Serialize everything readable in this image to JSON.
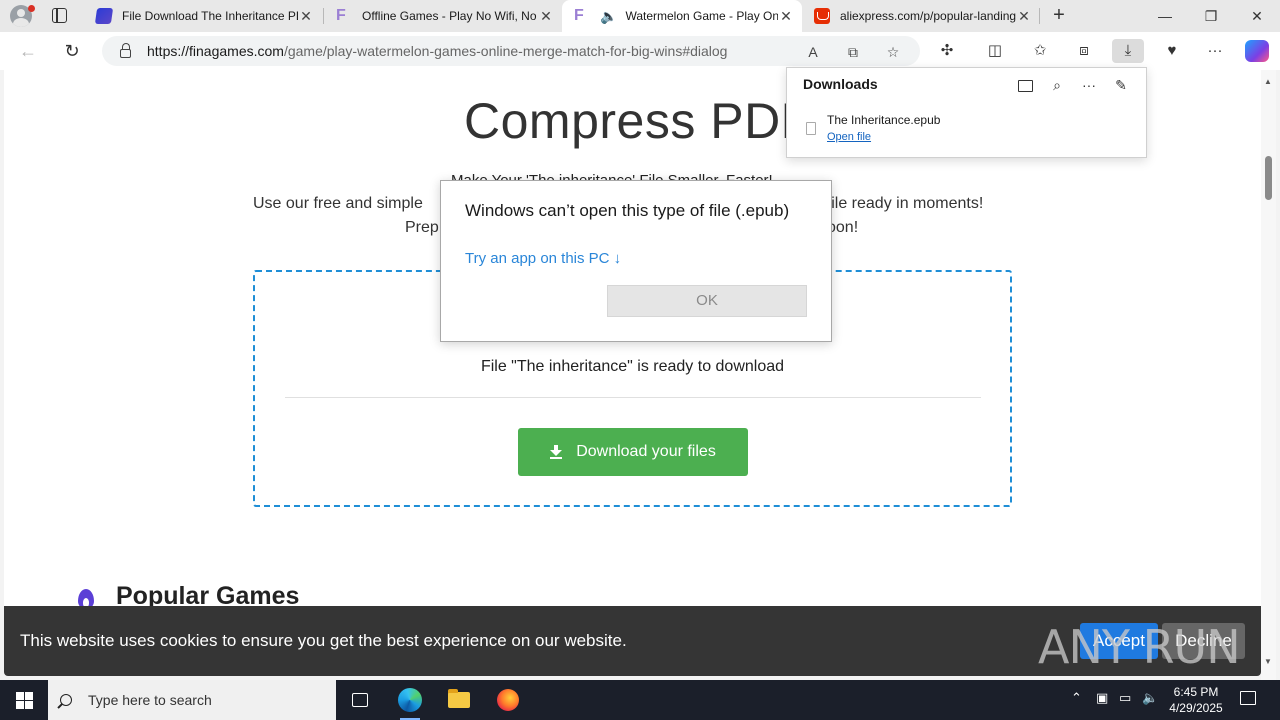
{
  "browser": {
    "tabs": [
      {
        "title": "File Download The Inheritance PDF",
        "favicon": "blue-book-icon",
        "active": false
      },
      {
        "title": "Offline Games - Play No Wifi, No",
        "favicon": "finagames-f-icon",
        "active": false
      },
      {
        "title": "Watermelon Game - Play Online",
        "favicon": "finagames-f-icon",
        "active": true,
        "audio": true
      },
      {
        "title": "aliexpress.com/p/popular-landing",
        "favicon": "aliexpress-cart-icon",
        "active": false
      }
    ],
    "url_host": "https://finagames.com",
    "url_path": "/game/play-watermelon-games-online-merge-match-for-big-wins#dialog"
  },
  "page": {
    "title": "Compress PDF",
    "subtitle": "Make Your 'The inheritance' File Smaller, Faster!",
    "desc_line1_left": "Use our free and simple",
    "desc_line1_right": "r file ready in moments!",
    "desc_line2_left": "Prep",
    "desc_line2_right": "oon!",
    "ready_text": "File \"The inheritance\" is ready to download",
    "download_button": "Download your files",
    "popular_title": "Popular Games"
  },
  "dialog": {
    "title": "Windows can’t open this type of file (.epub)",
    "link": "Try an app on this PC ↓",
    "ok": "OK"
  },
  "downloads": {
    "header": "Downloads",
    "file_name": "The Inheritance.epub",
    "open_file": "Open file"
  },
  "cookie": {
    "text": "This website uses cookies to ensure you get the best experience on our website.",
    "accept": "Accept",
    "decline": "Decline"
  },
  "watermark": "ANY RUN",
  "taskbar": {
    "search_placeholder": "Type here to search",
    "time": "6:45 PM",
    "date": "4/29/2025"
  },
  "colors": {
    "accent_blue": "#1f8ed6",
    "download_green": "#4caf50",
    "link_blue": "#2a86d8",
    "cookie_bg": "#353535",
    "accept_blue": "#1f7ae0",
    "taskbar_bg": "#1b1f2a"
  }
}
